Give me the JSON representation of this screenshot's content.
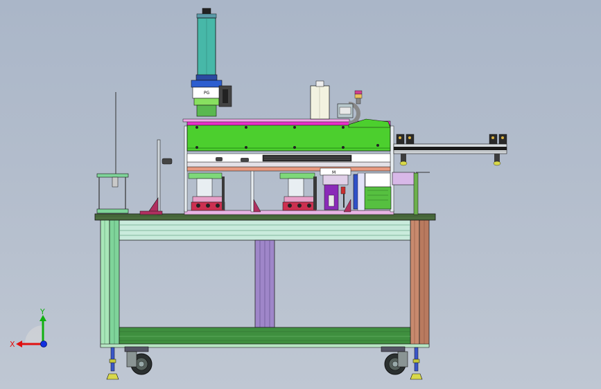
{
  "view": {
    "background": "#b3bdcc"
  },
  "labels": {
    "cylinder_plate": "PG",
    "lift_plate": "M"
  },
  "triad": {
    "x_label": "X",
    "y_label": "Y",
    "x_color": "#e01010",
    "y_color": "#10b010",
    "z_color": "#1030e0"
  }
}
